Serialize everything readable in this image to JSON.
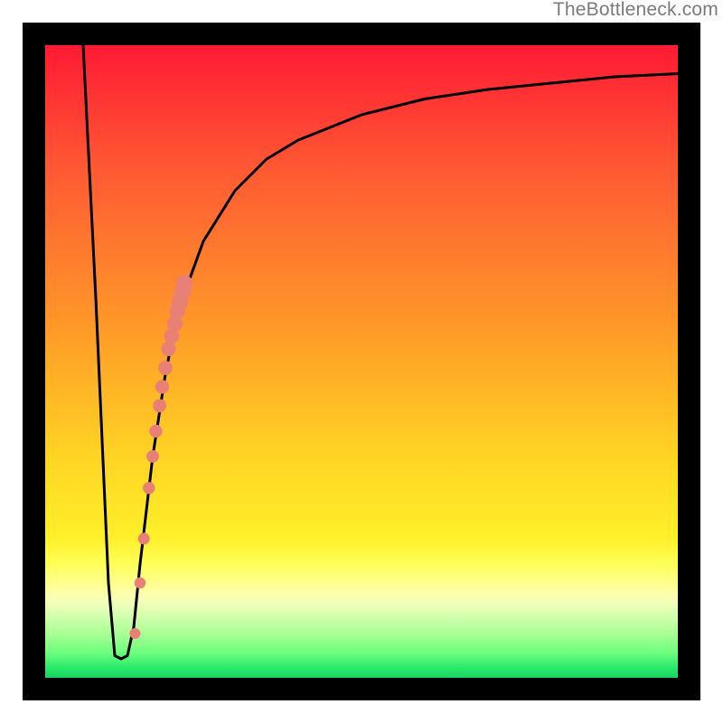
{
  "watermark": "TheBottleneck.com",
  "chart_data": {
    "type": "line",
    "title": "",
    "xlabel": "",
    "ylabel": "",
    "xlim": [
      0,
      100
    ],
    "ylim": [
      0,
      100
    ],
    "grid": false,
    "curve": {
      "description": "bottleneck-penalty curve: steep V-shaped dip on the left then asymptotic rise toward top-right",
      "x": [
        6,
        8,
        10,
        11,
        12,
        13,
        14,
        15,
        17,
        19,
        21,
        25,
        30,
        35,
        40,
        50,
        60,
        70,
        80,
        90,
        100
      ],
      "y": [
        100,
        60,
        15,
        3.5,
        3,
        3.5,
        8,
        18,
        35,
        48,
        58,
        69,
        77,
        82,
        85,
        89,
        91.5,
        93,
        94,
        95,
        95.5
      ]
    },
    "series": [
      {
        "name": "highlighted-points",
        "type": "scatter",
        "color": "#e88076",
        "x": [
          14.2,
          15.0,
          15.6,
          16.4,
          17.0,
          17.5,
          18.1,
          18.5,
          19.0,
          19.5,
          20.0,
          20.5,
          20.9,
          21.3,
          21.7,
          22.0
        ],
        "y": [
          7,
          15,
          22,
          30,
          35,
          39,
          43,
          46,
          49,
          52,
          54,
          56,
          58,
          59.5,
          61,
          62.3
        ]
      }
    ]
  }
}
